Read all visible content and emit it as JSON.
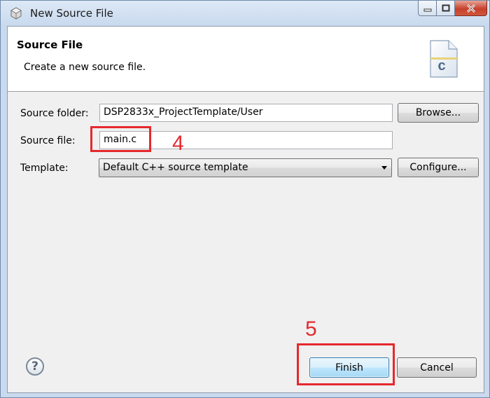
{
  "window": {
    "title": "New Source File",
    "controls": [
      "minimize-icon",
      "maximize-icon",
      "close-icon"
    ]
  },
  "header": {
    "title": "Source File",
    "description": "Create a new source file.",
    "icon_letter": "c"
  },
  "form": {
    "source_folder": {
      "label": "Source folder:",
      "value": "DSP2833x_ProjectTemplate/User",
      "button": "Browse..."
    },
    "source_file": {
      "label": "Source file:",
      "value": "main.c"
    },
    "template": {
      "label": "Template:",
      "selected": "Default C++ source template",
      "button": "Configure..."
    }
  },
  "footer": {
    "help_symbol": "?",
    "finish": "Finish",
    "cancel": "Cancel"
  },
  "annotations": {
    "step_source_file": "4",
    "step_finish": "5",
    "color": "#e5292d"
  }
}
